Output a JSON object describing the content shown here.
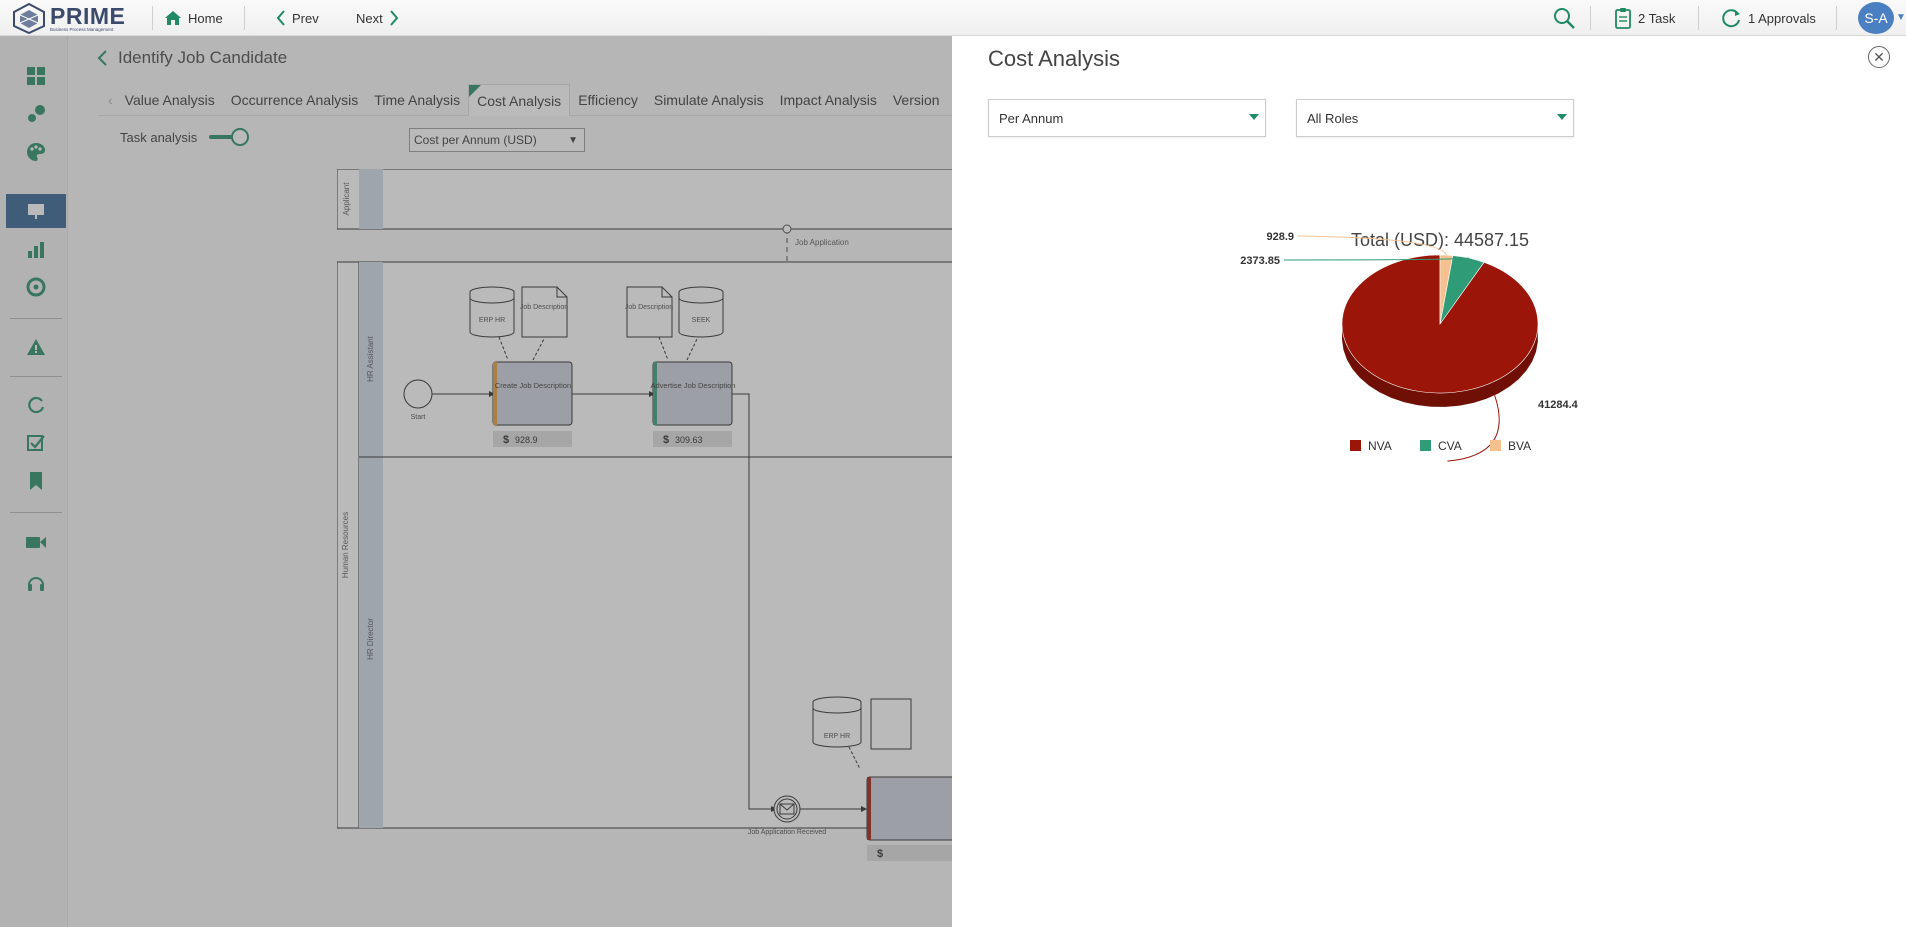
{
  "app": {
    "logo_text": "PRIME",
    "logo_subtitle": "Business Process Management"
  },
  "topbar": {
    "home_label": "Home",
    "prev_label": "Prev",
    "next_label": "Next",
    "task_label": "2 Task",
    "approvals_label": "1 Approvals",
    "avatar_initials": "S-A"
  },
  "main": {
    "page_title": "Identify Job Candidate",
    "tabs": [
      {
        "label": "Value Analysis"
      },
      {
        "label": "Occurrence Analysis"
      },
      {
        "label": "Time Analysis"
      },
      {
        "label": "Cost Analysis",
        "active": true
      },
      {
        "label": "Efficiency"
      },
      {
        "label": "Simulate Analysis"
      },
      {
        "label": "Impact Analysis"
      },
      {
        "label": "Version"
      }
    ],
    "task_analysis_label": "Task analysis",
    "task_analysis_on": true,
    "cost_select_value": "Cost per Annum (USD)",
    "diagram": {
      "lane_applicant": "Applicant",
      "pool_human_resources": "Human Resources",
      "lane_hr_assistant": "HR Assistant",
      "lane_hr_director": "HR Director",
      "message_flow_label": "Job Application",
      "start_label": "Start",
      "db_erp_hr": "ERP HR",
      "doc_job_description_1": "Job Description",
      "doc_job_description_2": "Job Description",
      "db_seek": "SEEK",
      "db_erp_hr_2": "ERP HR",
      "task_create": "Create Job Description",
      "task_advertise": "Advertise Job Description",
      "task_create_cost": "928.9",
      "task_advertise_cost": "309.63",
      "event_received": "Job Application Received",
      "currency_symbol": "$"
    }
  },
  "panel": {
    "title": "Cost Analysis",
    "period_dropdown": "Per Annum",
    "roles_dropdown": "All Roles"
  },
  "chart_data": {
    "type": "pie",
    "title": "Total (USD): 44587.15",
    "slices": [
      {
        "name": "NVA",
        "value": 41284.4,
        "color": "#9b1509"
      },
      {
        "name": "CVA",
        "value": 2373.85,
        "color": "#2f9b77"
      },
      {
        "name": "BVA",
        "value": 928.9,
        "color": "#f6c18f"
      }
    ],
    "legend_position": "bottom",
    "three_d": true
  }
}
